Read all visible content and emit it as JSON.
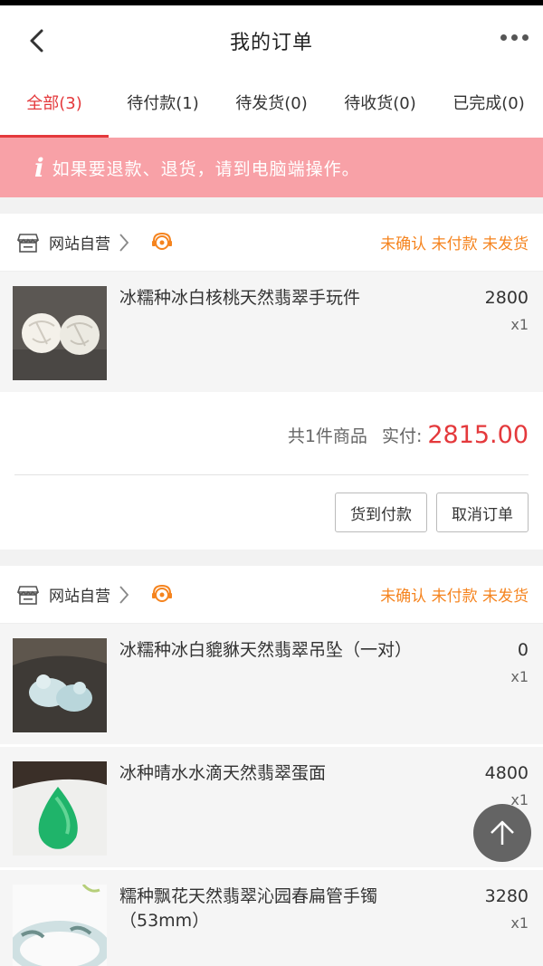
{
  "header": {
    "title": "我的订单",
    "back_icon": "chevron-left-icon",
    "more_icon": "more-dots-icon"
  },
  "tabs": [
    {
      "label": "全部(3)",
      "active": true
    },
    {
      "label": "待付款(1)",
      "active": false
    },
    {
      "label": "待发货(0)",
      "active": false
    },
    {
      "label": "待收货(0)",
      "active": false
    },
    {
      "label": "已完成(0)",
      "active": false
    }
  ],
  "notice": {
    "icon": "info-icon",
    "text": "如果要退款、退货，请到电脑端操作。"
  },
  "orders": [
    {
      "store": "网站自营",
      "status": "未确认 未付款 未发货",
      "items": [
        {
          "name": "冰糯种冰白核桃天然翡翠手玩件",
          "price": "2800",
          "qty": "x1"
        }
      ],
      "summary": {
        "count": "共1件商品",
        "pay_label": "实付:",
        "amount": "2815.00"
      },
      "actions": [
        "货到付款",
        "取消订单"
      ]
    },
    {
      "store": "网站自营",
      "status": "未确认 未付款 未发货",
      "items": [
        {
          "name": "冰糯种冰白貔貅天然翡翠吊坠（一对）",
          "price": "0",
          "qty": "x1"
        },
        {
          "name": "冰种晴水水滴天然翡翠蛋面",
          "price": "4800",
          "qty": "x1"
        },
        {
          "name": "糯种飘花天然翡翠沁园春扁管手镯（53mm）",
          "price": "3280",
          "qty": "x1"
        }
      ]
    }
  ],
  "colors": {
    "accent": "#e4393c",
    "status": "#f5841f",
    "notice_bg": "#f8a1a7"
  },
  "scroll_top_icon": "arrow-up-icon"
}
